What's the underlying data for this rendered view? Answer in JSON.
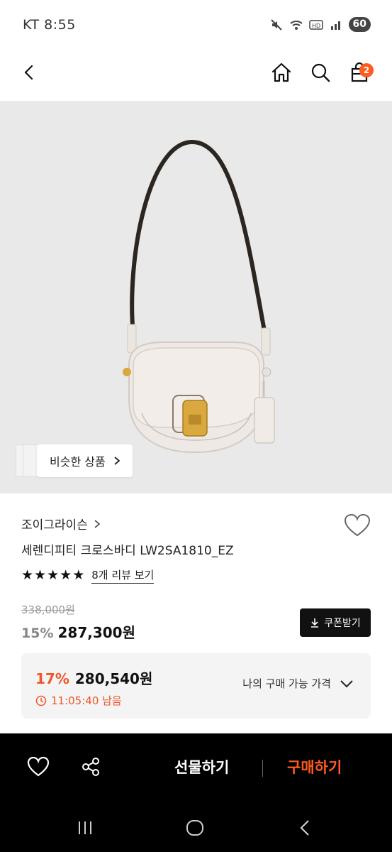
{
  "status_bar": {
    "carrier_time": "KT 8:55",
    "battery": "60"
  },
  "header": {
    "cart_count": "2"
  },
  "hero": {
    "similar_label": "비슷한 상품"
  },
  "product": {
    "brand": "조이그라이슨",
    "name": "세렌디피티 크로스바디 LW2SA1810_EZ",
    "rating_stars": 5,
    "review_link": "8개 리뷰 보기",
    "original_price": "338,000원",
    "discount_pct": "15%",
    "sale_price": "287,300원",
    "coupon_label": "쿠폰받기"
  },
  "my_price": {
    "discount_pct": "17%",
    "price": "280,540원",
    "timer": "11:05:40 남음",
    "label": "나의 구매 가능 가격"
  },
  "action_bar": {
    "gift_label": "선물하기",
    "buy_label": "구매하기"
  },
  "colors": {
    "accent": "#ff5a1f",
    "price_accent": "#f0562b",
    "bar_bg": "#000000"
  }
}
